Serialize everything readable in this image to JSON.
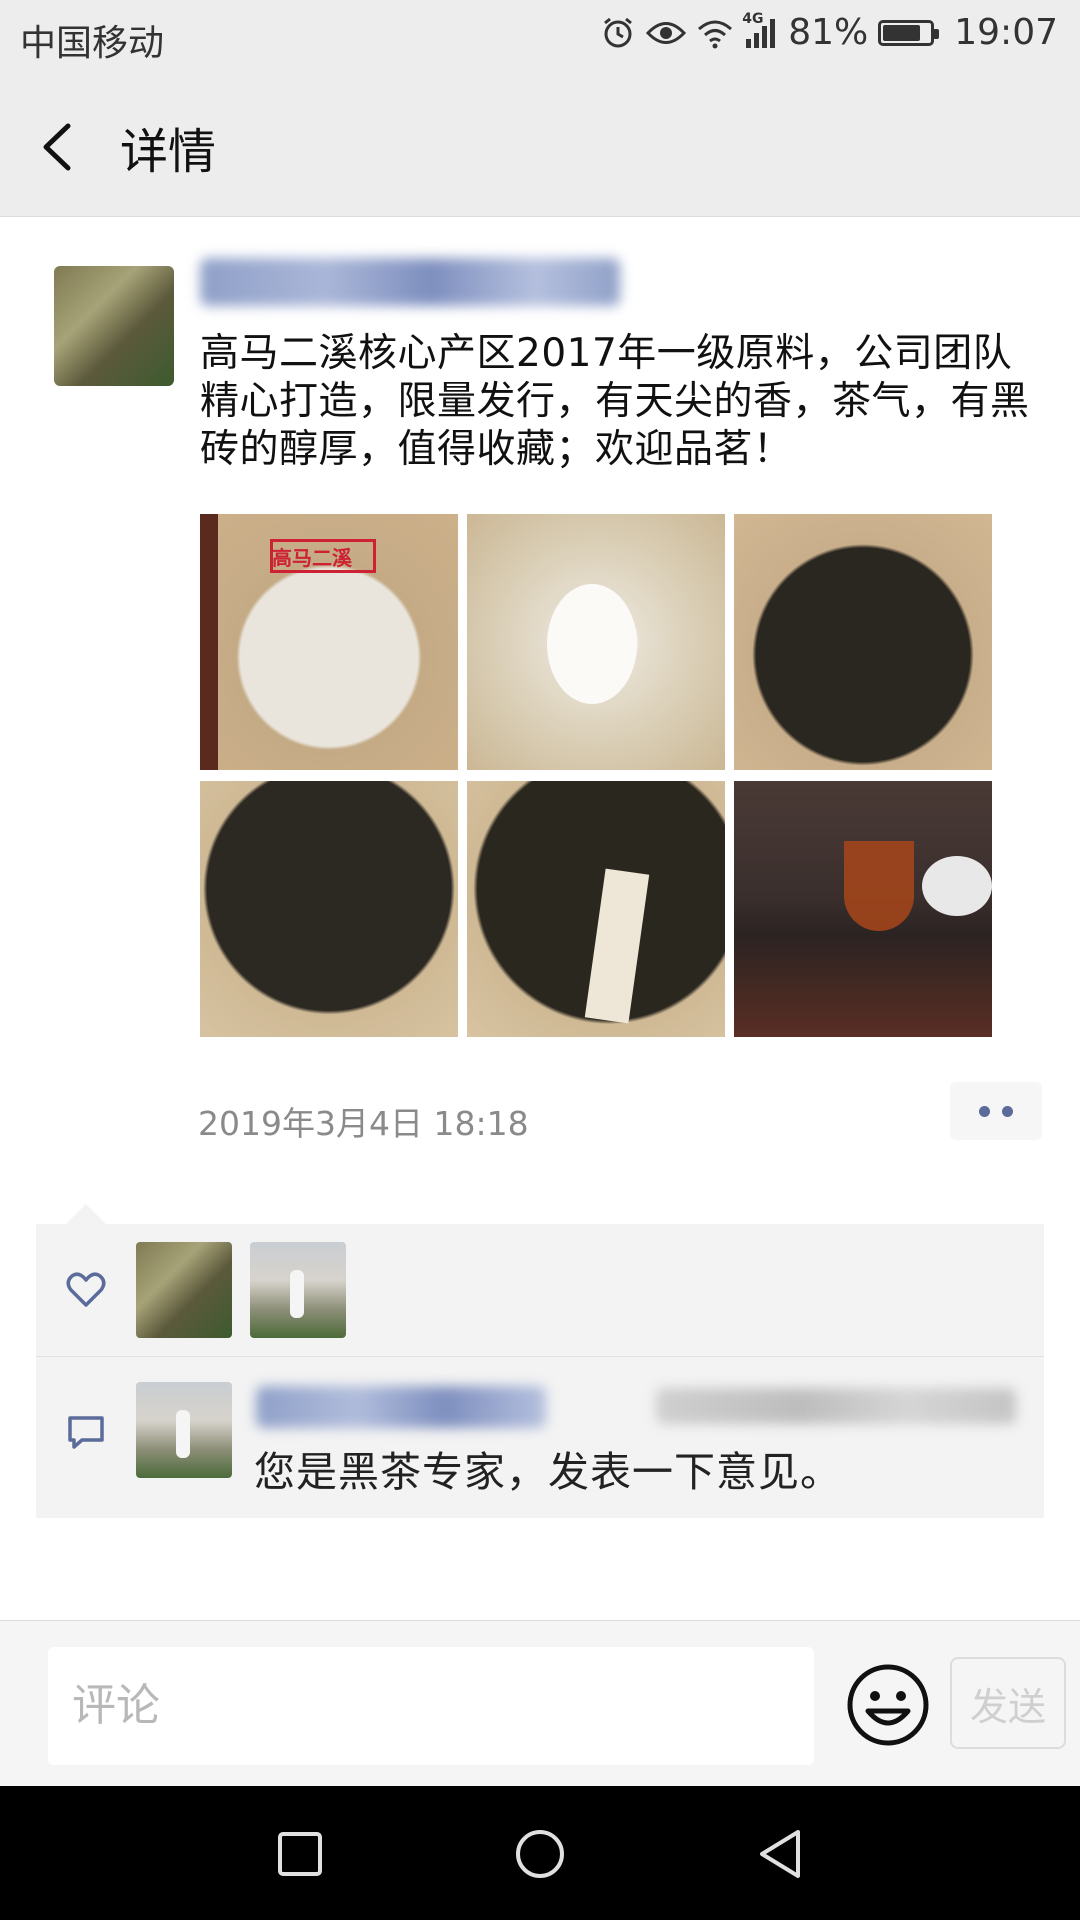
{
  "status_bar": {
    "carrier": "中国移动",
    "network": "4G",
    "battery_percent": "81%",
    "battery_level": 0.81,
    "time": "19:07",
    "icons": [
      "alarm-icon",
      "eye-icon",
      "wifi-icon",
      "signal-icon",
      "battery-icon"
    ]
  },
  "nav": {
    "back_icon": "chevron-left-icon",
    "title": "详情"
  },
  "post": {
    "text": "高马二溪核心产区2017年一级原料，公司团队精心打造，限量发行，有天尖的香，茶气，有黑砖的醇厚，值得收藏；欢迎品茗！",
    "images": [
      {
        "label": "高马二溪"
      },
      {
        "label": ""
      },
      {
        "label": ""
      },
      {
        "label": ""
      },
      {
        "label": ""
      },
      {
        "label": ""
      }
    ],
    "timestamp": "2019年3月4日 18:18",
    "more_icon": "more-dots-icon"
  },
  "interactions": {
    "like_icon": "heart-icon",
    "comment_icon": "comment-icon",
    "comments": [
      {
        "text": "您是黑茶专家，发表一下意见。"
      }
    ]
  },
  "input_bar": {
    "placeholder": "评论",
    "emoji_icon": "smiley-icon",
    "send_label": "发送"
  },
  "system_nav": {
    "icons": [
      "recents-square-icon",
      "home-circle-icon",
      "back-triangle-icon"
    ]
  }
}
